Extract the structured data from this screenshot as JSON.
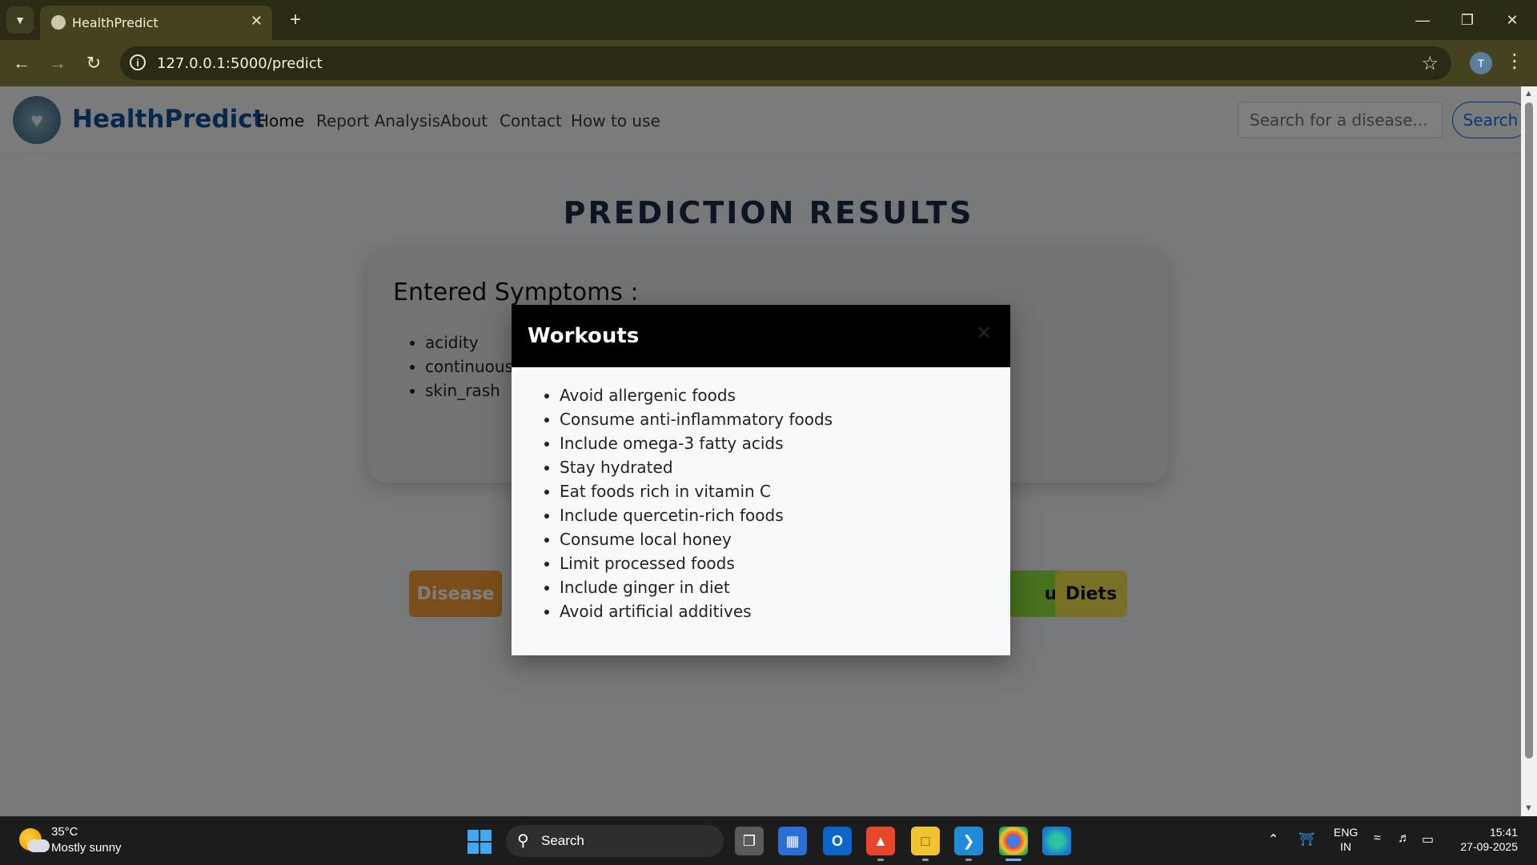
{
  "browser": {
    "tab_title": "HealthPredict",
    "url": "127.0.0.1:5000/predict",
    "profile_initial": "T"
  },
  "site": {
    "brand": "HealthPredict",
    "nav": [
      "Home",
      "Report Analysis",
      "About",
      "Contact",
      "How to use"
    ],
    "search_placeholder": "Search for a disease...",
    "search_button": "Search"
  },
  "results": {
    "title": "PREDICTION RESULTS",
    "heading": "Entered Symptoms :",
    "symptoms": [
      "acidity",
      "continuous_",
      "skin_rash"
    ],
    "buttons": {
      "disease": "Disease",
      "workouts_partial": "uts",
      "diets": "Diets"
    },
    "button_colors": {
      "disease": "#f39c34",
      "workouts": "#8ee23a",
      "diets": "#f1e24a"
    }
  },
  "modal": {
    "title": "Workouts",
    "close_icon": "close-icon",
    "items": [
      "Avoid allergenic foods",
      "Consume anti-inflammatory foods",
      "Include omega-3 fatty acids",
      "Stay hydrated",
      "Eat foods rich in vitamin C",
      "Include quercetin-rich foods",
      "Consume local honey",
      "Limit processed foods",
      "Include ginger in diet",
      "Avoid artificial additives"
    ]
  },
  "taskbar": {
    "weather_temp": "35°C",
    "weather_desc": "Mostly sunny",
    "search_label": "Search",
    "lang_line1": "ENG",
    "lang_line2": "IN",
    "time": "15:41",
    "date": "27-09-2025"
  }
}
